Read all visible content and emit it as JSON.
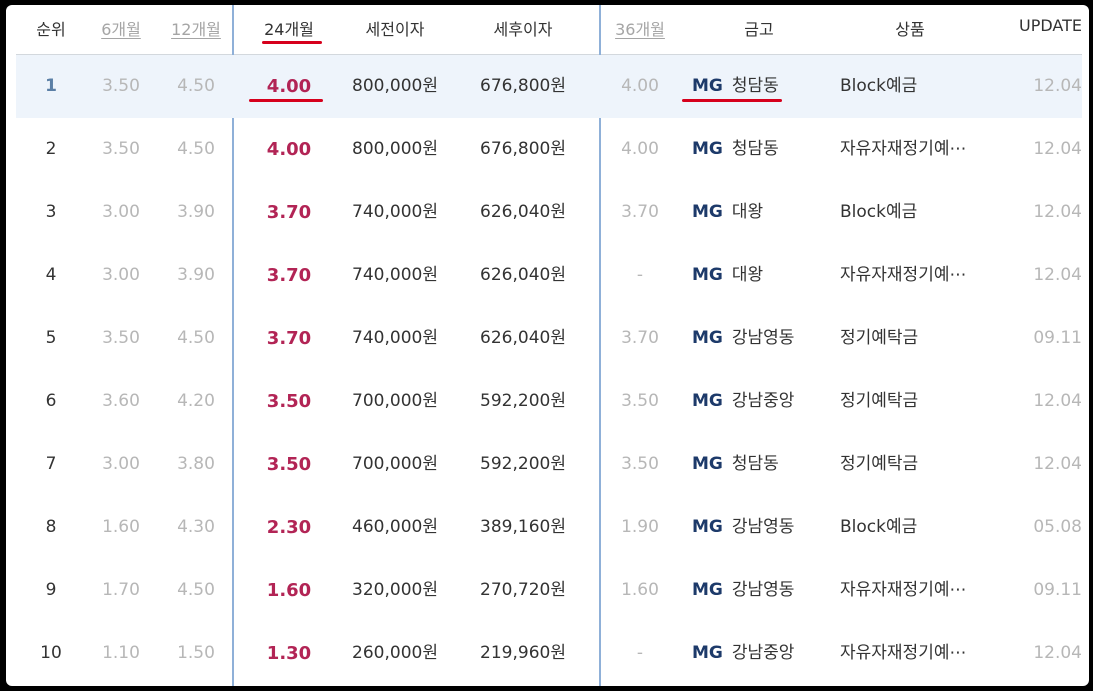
{
  "header": {
    "rank": "순위",
    "m6": "6개월",
    "m12": "12개월",
    "m24": "24개월",
    "pretax": "세전이자",
    "aftertax": "세후이자",
    "m36": "36개월",
    "bank": "금고",
    "product": "상품",
    "update": "UPDATE"
  },
  "colors": {
    "accent_red": "#d6001c",
    "rate_red": "#b22455",
    "divider_blue": "#8fb0d8",
    "highlight_row": "#eef4fb",
    "mg_navy": "#1d3a6a"
  },
  "rows": [
    {
      "rank": "1",
      "m6": "3.50",
      "m12": "4.50",
      "m24": "4.00",
      "pretax": "800,000원",
      "aftertax": "676,800원",
      "m36": "4.00",
      "mg": "MG",
      "bank": "청담동",
      "product": "Block예금",
      "update": "12.04"
    },
    {
      "rank": "2",
      "m6": "3.50",
      "m12": "4.50",
      "m24": "4.00",
      "pretax": "800,000원",
      "aftertax": "676,800원",
      "m36": "4.00",
      "mg": "MG",
      "bank": "청담동",
      "product": "자유자재정기예⋯",
      "update": "12.04"
    },
    {
      "rank": "3",
      "m6": "3.00",
      "m12": "3.90",
      "m24": "3.70",
      "pretax": "740,000원",
      "aftertax": "626,040원",
      "m36": "3.70",
      "mg": "MG",
      "bank": "대왕",
      "product": "Block예금",
      "update": "12.04"
    },
    {
      "rank": "4",
      "m6": "3.00",
      "m12": "3.90",
      "m24": "3.70",
      "pretax": "740,000원",
      "aftertax": "626,040원",
      "m36": "-",
      "mg": "MG",
      "bank": "대왕",
      "product": "자유자재정기예⋯",
      "update": "12.04"
    },
    {
      "rank": "5",
      "m6": "3.50",
      "m12": "4.50",
      "m24": "3.70",
      "pretax": "740,000원",
      "aftertax": "626,040원",
      "m36": "3.70",
      "mg": "MG",
      "bank": "강남영동",
      "product": "정기예탁금",
      "update": "09.11"
    },
    {
      "rank": "6",
      "m6": "3.60",
      "m12": "4.20",
      "m24": "3.50",
      "pretax": "700,000원",
      "aftertax": "592,200원",
      "m36": "3.50",
      "mg": "MG",
      "bank": "강남중앙",
      "product": "정기예탁금",
      "update": "12.04"
    },
    {
      "rank": "7",
      "m6": "3.00",
      "m12": "3.80",
      "m24": "3.50",
      "pretax": "700,000원",
      "aftertax": "592,200원",
      "m36": "3.50",
      "mg": "MG",
      "bank": "청담동",
      "product": "정기예탁금",
      "update": "12.04"
    },
    {
      "rank": "8",
      "m6": "1.60",
      "m12": "4.30",
      "m24": "2.30",
      "pretax": "460,000원",
      "aftertax": "389,160원",
      "m36": "1.90",
      "mg": "MG",
      "bank": "강남영동",
      "product": "Block예금",
      "update": "05.08"
    },
    {
      "rank": "9",
      "m6": "1.70",
      "m12": "4.50",
      "m24": "1.60",
      "pretax": "320,000원",
      "aftertax": "270,720원",
      "m36": "1.60",
      "mg": "MG",
      "bank": "강남영동",
      "product": "자유자재정기예⋯",
      "update": "09.11"
    },
    {
      "rank": "10",
      "m6": "1.10",
      "m12": "1.50",
      "m24": "1.30",
      "pretax": "260,000원",
      "aftertax": "219,960원",
      "m36": "-",
      "mg": "MG",
      "bank": "강남중앙",
      "product": "자유자재정기예⋯",
      "update": "12.04"
    }
  ]
}
